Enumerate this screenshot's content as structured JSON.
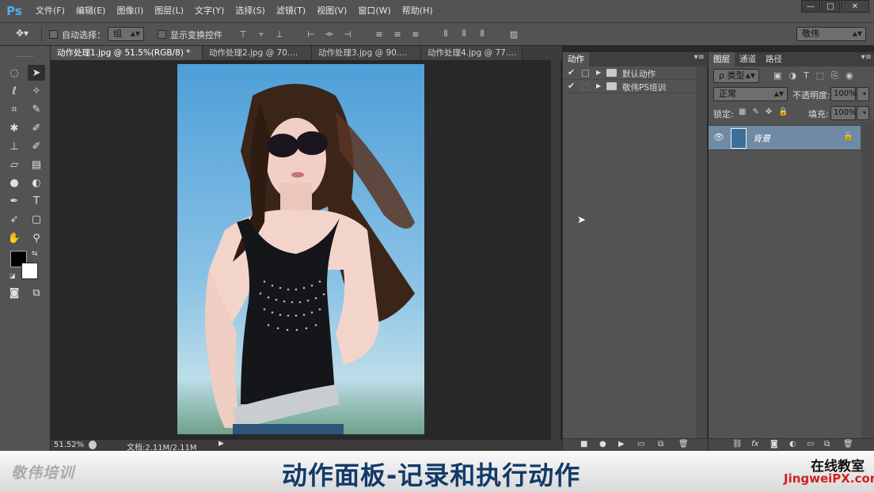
{
  "app": {
    "logo": "Ps"
  },
  "menu": [
    "文件(F)",
    "编辑(E)",
    "图像(I)",
    "图层(L)",
    "文字(Y)",
    "选择(S)",
    "滤镜(T)",
    "视图(V)",
    "窗口(W)",
    "帮助(H)"
  ],
  "window_buttons": [
    "—",
    "□",
    "✕"
  ],
  "options": {
    "auto_select_label": "自动选择：",
    "auto_select_value": "组",
    "show_transform_label": "显示变换控件",
    "workspace": "敬伟"
  },
  "doc_tabs": [
    "动作处理1.jpg @ 51.5%(RGB/8) *",
    "动作处理2.jpg @ 70....",
    "动作处理3.jpg @ 90....",
    "动作处理4.jpg @ 77...."
  ],
  "status": {
    "zoom": "51.52%",
    "doc_size": "文档:2.11M/2.11M"
  },
  "actions_panel": {
    "tab": "动作",
    "rows": [
      {
        "label": "默认动作",
        "checked": true
      },
      {
        "label": "敬伟PS培训",
        "checked": true
      }
    ]
  },
  "layers_panel": {
    "tabs": [
      "图层",
      "通道",
      "路径"
    ],
    "filter_label": "ρ 类型",
    "blend_mode": "正常",
    "opacity_label": "不透明度:",
    "opacity_value": "100%",
    "lock_label": "锁定:",
    "fill_label": "填充:",
    "fill_value": "100%",
    "layer_name": "背景"
  },
  "banner": {
    "brand": "敬伟培训",
    "title": "动作面板-记录和执行动作",
    "right_top": "在线教室",
    "right_bottom": "JingweiPX.com"
  },
  "colors": {
    "ps_blue": "#4fb0f0",
    "banner_title": "#123a6a",
    "url_red": "#d21f1f",
    "layer_selected": "#6f8aa3"
  }
}
